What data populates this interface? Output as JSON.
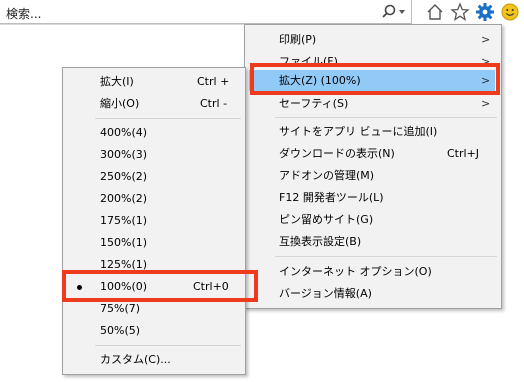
{
  "toolbar": {
    "search_text": "検索...",
    "icons": [
      "search-icon",
      "home-icon",
      "favorites-star-icon",
      "gear-icon",
      "smiley-icon"
    ]
  },
  "main_menu": {
    "items": [
      {
        "label": "印刷(P)",
        "submenu": true
      },
      {
        "label": "ファイル(F)",
        "submenu": true
      },
      {
        "label": "拡大(Z) (100%)",
        "submenu": true,
        "highlighted": true
      },
      {
        "label": "セーフティ(S)",
        "submenu": true
      },
      {
        "label": "サイトをアプリ ビューに追加(I)"
      },
      {
        "label": "ダウンロードの表示(N)",
        "shortcut": "Ctrl+J"
      },
      {
        "label": "アドオンの管理(M)"
      },
      {
        "label": "F12 開発者ツール(L)"
      },
      {
        "label": "ピン留めサイト(G)"
      },
      {
        "label": "互換表示設定(B)"
      },
      {
        "label": "インターネット オプション(O)"
      },
      {
        "label": "バージョン情報(A)"
      }
    ],
    "arrow_glyph": ">"
  },
  "zoom_menu": {
    "items": [
      {
        "label": "拡大(I)",
        "shortcut": "Ctrl +"
      },
      {
        "label": "縮小(O)",
        "shortcut": "Ctrl -"
      },
      {
        "label": "400%(4)"
      },
      {
        "label": "300%(3)"
      },
      {
        "label": "250%(2)"
      },
      {
        "label": "200%(2)"
      },
      {
        "label": "175%(1)"
      },
      {
        "label": "150%(1)"
      },
      {
        "label": "125%(1)"
      },
      {
        "label": "100%(0)",
        "shortcut": "Ctrl+0",
        "selected": true
      },
      {
        "label": "75%(7)"
      },
      {
        "label": "50%(5)"
      },
      {
        "label": "カスタム(C)..."
      }
    ]
  },
  "colors": {
    "highlight": "#91c9f7",
    "annotation_red": "#ee3b1e",
    "gear_blue": "#1a6fc4",
    "smiley_yellow": "#f2c318"
  }
}
